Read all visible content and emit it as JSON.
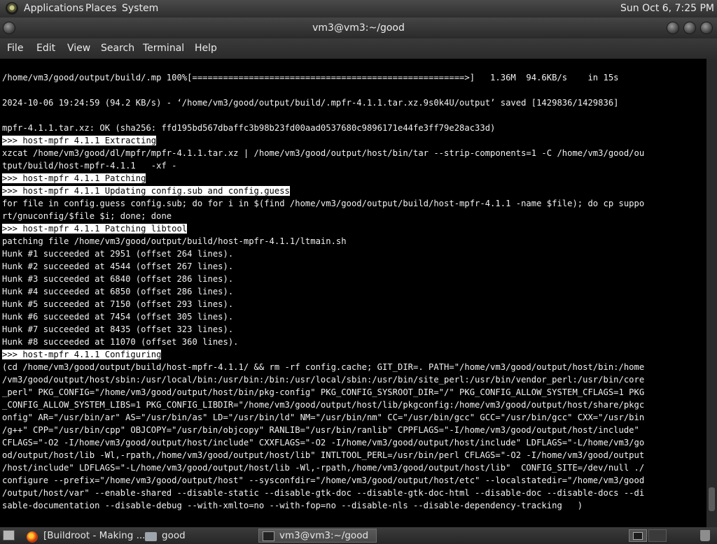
{
  "top_panel": {
    "applications_label": "Applications",
    "places_label": "Places",
    "system_label": "System",
    "clock": "Sun Oct  6,  7:25 PM"
  },
  "window": {
    "title": "vm3@vm3:~/good"
  },
  "menubar": [
    "File",
    "Edit",
    "View",
    "Search",
    "Terminal",
    "Help"
  ],
  "terminal_lines": [
    {
      "text": "/home/vm3/good/output/build/.mp 100%[=====================================================>]   1.36M  94.6KB/s    in 15s",
      "highlight": false
    },
    {
      "text": "",
      "highlight": false
    },
    {
      "text": "2024-10-06 19:24:59 (94.2 KB/s) - ‘/home/vm3/good/output/build/.mpfr-4.1.1.tar.xz.9s0k4U/output’ saved [1429836/1429836]",
      "highlight": false
    },
    {
      "text": "",
      "highlight": false
    },
    {
      "text": "mpfr-4.1.1.tar.xz: OK (sha256: ffd195bd567dbaffc3b98b23fd00aad0537680c9896171e44fe3ff79e28ac33d)",
      "highlight": false
    },
    {
      "text": ">>> host-mpfr 4.1.1 Extracting",
      "highlight": true
    },
    {
      "text": "xzcat /home/vm3/good/dl/mpfr/mpfr-4.1.1.tar.xz | /home/vm3/good/output/host/bin/tar --strip-components=1 -C /home/vm3/good/ou",
      "highlight": false
    },
    {
      "text": "tput/build/host-mpfr-4.1.1   -xf -",
      "highlight": false
    },
    {
      "text": ">>> host-mpfr 4.1.1 Patching",
      "highlight": true
    },
    {
      "text": ">>> host-mpfr 4.1.1 Updating config.sub and config.guess",
      "highlight": true
    },
    {
      "text": "for file in config.guess config.sub; do for i in $(find /home/vm3/good/output/build/host-mpfr-4.1.1 -name $file); do cp suppo",
      "highlight": false
    },
    {
      "text": "rt/gnuconfig/$file $i; done; done",
      "highlight": false
    },
    {
      "text": ">>> host-mpfr 4.1.1 Patching libtool",
      "highlight": true
    },
    {
      "text": "patching file /home/vm3/good/output/build/host-mpfr-4.1.1/ltmain.sh",
      "highlight": false
    },
    {
      "text": "Hunk #1 succeeded at 2951 (offset 264 lines).",
      "highlight": false
    },
    {
      "text": "Hunk #2 succeeded at 4544 (offset 267 lines).",
      "highlight": false
    },
    {
      "text": "Hunk #3 succeeded at 6840 (offset 286 lines).",
      "highlight": false
    },
    {
      "text": "Hunk #4 succeeded at 6850 (offset 286 lines).",
      "highlight": false
    },
    {
      "text": "Hunk #5 succeeded at 7150 (offset 293 lines).",
      "highlight": false
    },
    {
      "text": "Hunk #6 succeeded at 7454 (offset 305 lines).",
      "highlight": false
    },
    {
      "text": "Hunk #7 succeeded at 8435 (offset 323 lines).",
      "highlight": false
    },
    {
      "text": "Hunk #8 succeeded at 11070 (offset 360 lines).",
      "highlight": false
    },
    {
      "text": ">>> host-mpfr 4.1.1 Configuring",
      "highlight": true
    },
    {
      "text": "(cd /home/vm3/good/output/build/host-mpfr-4.1.1/ && rm -rf config.cache; GIT_DIR=. PATH=\"/home/vm3/good/output/host/bin:/home",
      "highlight": false
    },
    {
      "text": "/vm3/good/output/host/sbin:/usr/local/bin:/usr/bin:/bin:/usr/local/sbin:/usr/bin/site_perl:/usr/bin/vendor_perl:/usr/bin/core",
      "highlight": false
    },
    {
      "text": "_perl\" PKG_CONFIG=\"/home/vm3/good/output/host/bin/pkg-config\" PKG_CONFIG_SYSROOT_DIR=\"/\" PKG_CONFIG_ALLOW_SYSTEM_CFLAGS=1 PKG",
      "highlight": false
    },
    {
      "text": "_CONFIG_ALLOW_SYSTEM_LIBS=1 PKG_CONFIG_LIBDIR=\"/home/vm3/good/output/host/lib/pkgconfig:/home/vm3/good/output/host/share/pkgc",
      "highlight": false
    },
    {
      "text": "onfig\" AR=\"/usr/bin/ar\" AS=\"/usr/bin/as\" LD=\"/usr/bin/ld\" NM=\"/usr/bin/nm\" CC=\"/usr/bin/gcc\" GCC=\"/usr/bin/gcc\" CXX=\"/usr/bin",
      "highlight": false
    },
    {
      "text": "/g++\" CPP=\"/usr/bin/cpp\" OBJCOPY=\"/usr/bin/objcopy\" RANLIB=\"/usr/bin/ranlib\" CPPFLAGS=\"-I/home/vm3/good/output/host/include\"",
      "highlight": false
    },
    {
      "text": "CFLAGS=\"-O2 -I/home/vm3/good/output/host/include\" CXXFLAGS=\"-O2 -I/home/vm3/good/output/host/include\" LDFLAGS=\"-L/home/vm3/go",
      "highlight": false
    },
    {
      "text": "od/output/host/lib -Wl,-rpath,/home/vm3/good/output/host/lib\" INTLTOOL_PERL=/usr/bin/perl CFLAGS=\"-O2 -I/home/vm3/good/output",
      "highlight": false
    },
    {
      "text": "/host/include\" LDFLAGS=\"-L/home/vm3/good/output/host/lib -Wl,-rpath,/home/vm3/good/output/host/lib\"  CONFIG_SITE=/dev/null ./",
      "highlight": false
    },
    {
      "text": "configure --prefix=\"/home/vm3/good/output/host\" --sysconfdir=\"/home/vm3/good/output/host/etc\" --localstatedir=\"/home/vm3/good",
      "highlight": false
    },
    {
      "text": "/output/host/var\" --enable-shared --disable-static --disable-gtk-doc --disable-gtk-doc-html --disable-doc --disable-docs --di",
      "highlight": false
    },
    {
      "text": "sable-documentation --disable-debug --with-xmlto=no --with-fop=no --disable-nls --disable-dependency-tracking   )",
      "highlight": false
    }
  ],
  "taskbar": {
    "buildroot_label": "[Buildroot - Making ...",
    "good_label": "good",
    "terminal_label": "vm3@vm3:~/good"
  }
}
